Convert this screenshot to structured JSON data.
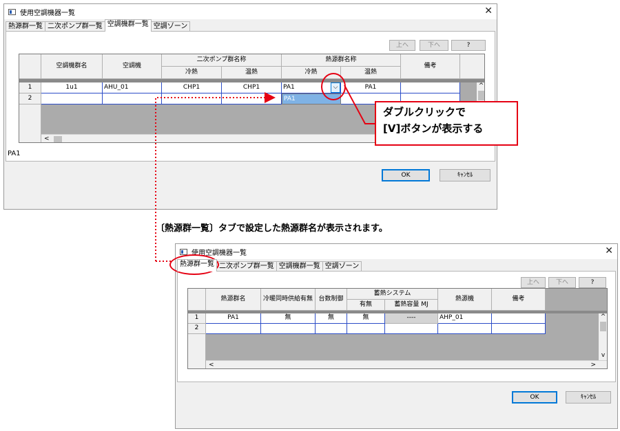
{
  "dialog_top": {
    "title": "使用空調機器一覧",
    "close": "✕",
    "tabs": [
      "熱源群一覧",
      "二次ポンプ群一覧",
      "空調機群一覧",
      "空調ゾーン"
    ],
    "side_buttons": {
      "up": "上へ",
      "down": "下へ",
      "help": "?"
    },
    "group_headers": {
      "pump": "二次ポンプ群名称",
      "heat": "熱源群名称"
    },
    "columns": [
      "空調機群名",
      "空調機",
      "冷熱",
      "温熱",
      "冷熱",
      "温熱",
      "備考"
    ],
    "rows": [
      {
        "no": "1",
        "cells": [
          "1u1",
          "AHU_01",
          "CHP1",
          "CHP1",
          "PA1",
          "PA1",
          ""
        ]
      },
      {
        "no": "2",
        "cells": [
          "",
          "",
          "",
          "",
          "",
          "",
          ""
        ]
      }
    ],
    "dropdown_option": "PA1",
    "status": "PA1",
    "ok": "OK",
    "cancel": "ｷｬﾝｾﾙ"
  },
  "callout": {
    "line1": "ダブルクリックで",
    "line2": "[V]ボタンが表示する"
  },
  "note": "〔熱源群一覧〕タブで設定した熱源群名が表示されます。",
  "dialog_bottom": {
    "title": "使用空調機器一覧",
    "close": "✕",
    "tabs": [
      "熱源群一覧",
      "二次ポンプ群一覧",
      "空調機群一覧",
      "空調ゾーン"
    ],
    "side_buttons": {
      "up": "上へ",
      "down": "下へ",
      "help": "?"
    },
    "group_header": "蓄熱システム",
    "columns": [
      "熱源群名",
      "冷暖同時供給有無",
      "台数制御",
      "有無",
      "蓄熱容量 MJ",
      "熱源機",
      "備考"
    ],
    "rows": [
      {
        "no": "1",
        "cells": [
          "PA1",
          "無",
          "無",
          "無",
          "----",
          "AHP_01",
          ""
        ]
      },
      {
        "no": "2",
        "cells": [
          "",
          "",
          "",
          "",
          "",
          "",
          ""
        ]
      }
    ],
    "ok": "OK",
    "cancel": "ｷｬﾝｾﾙ"
  },
  "colors": {
    "accent_red": "#e50012",
    "selection_blue": "#0078d7",
    "dropdown_selected": "#7fb2e5"
  }
}
